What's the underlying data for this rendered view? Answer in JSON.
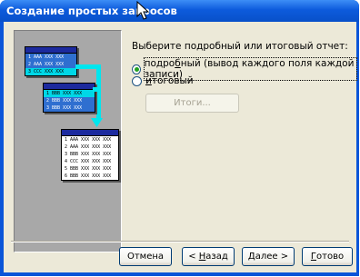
{
  "window": {
    "title": "Создание простых запросов"
  },
  "illustration": {
    "source_table1": [
      "1 AAA XXX XXX",
      "2 AAA XXX XXX",
      "3 CCC XXX XXX"
    ],
    "source_table2": [
      "1 BBB XXX XXX",
      "2 BBB XXX XXX",
      "3 BBB XXX XXX"
    ],
    "result_table": [
      "1 AAA XXX XXX XXX",
      "2 AAA XXX XXX XXX",
      "3 BBB XXX XXX XXX",
      "4 CCC XXX XXX XXX",
      "5 BBB XXX XXX XXX",
      "6 BBB XXX XXX XXX"
    ]
  },
  "options": {
    "prompt": "Выберите подробный или итоговый отчет:",
    "detailed_pre": "подро",
    "detailed_key": "б",
    "detailed_post": "ный (вывод каждого поля каждой записи)",
    "summary_key": "и",
    "summary_post": "тоговый",
    "summary_button": "Итоги...",
    "selected": "подробный"
  },
  "footer": {
    "cancel": "Отмена",
    "back_pre": "< ",
    "back_key": "Н",
    "back_post": "азад",
    "next_key": "Д",
    "next_post": "алее >",
    "finish_key": "Г",
    "finish_post": "отово"
  },
  "colors": {
    "title_bar": "#0a55d8",
    "client": "#ece9d8",
    "illustration_bg": "#a8a8a8",
    "highlight": "#00e6ee"
  }
}
